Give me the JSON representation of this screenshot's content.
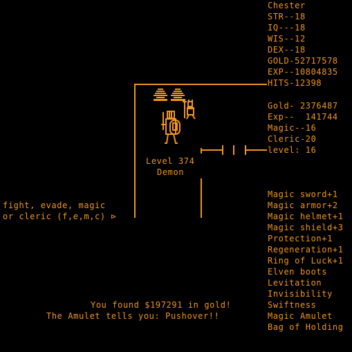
{
  "colors": {
    "background": "#000000",
    "phosphor": "#f0961e"
  },
  "character": {
    "name": "Chester",
    "stats": [
      "STR--18",
      "IQ---18",
      "WIS--12",
      "DEX--18",
      "GOLD-52717578",
      "EXP--10804835",
      "HITS-12398"
    ]
  },
  "status": [
    "Gold- 2376487",
    "Exp--  141744",
    "Magic--16",
    "Cleric-20",
    "level: 16"
  ],
  "monster": {
    "level": "Level 374",
    "name": "Demon",
    "sprites": [
      "treasure-pile-icon",
      "treasure-pile-icon",
      "demon-icon",
      "knight-with-shield-icon"
    ]
  },
  "prompt": {
    "line1": "fight, evade, magic",
    "line2": "or cleric (f,e,m,c) ⊳"
  },
  "inventory": [
    "Magic sword+1",
    "Magic armor+2",
    "Magic helmet+1",
    "Magic shield+3",
    "Protection+1",
    "Regeneration+1",
    "Ring of Luck+1",
    "Elven boots",
    "Levitation",
    "Invisibility",
    "Swiftness",
    "Magic Amulet",
    "Bag of Holding"
  ],
  "messages": {
    "found": "You found $197291 in gold!",
    "amulet": "The Amulet tells you: Pushover!!"
  }
}
